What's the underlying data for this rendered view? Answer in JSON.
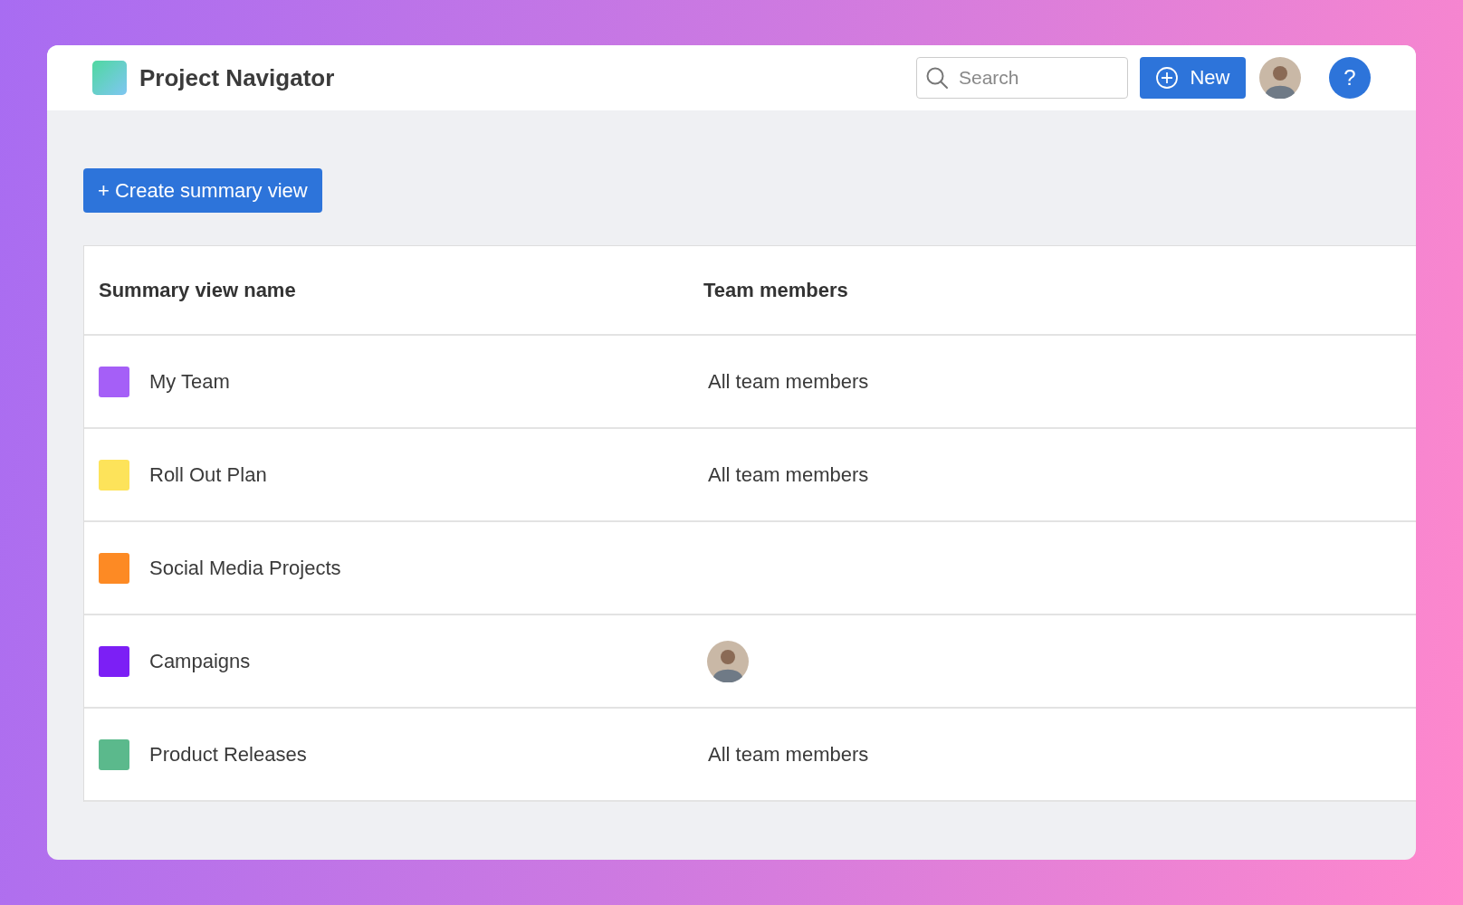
{
  "header": {
    "title": "Project Navigator",
    "search": {
      "placeholder": "Search"
    },
    "new_button": "New",
    "help_button": "?"
  },
  "create_button": "+ Create summary view",
  "table": {
    "columns": [
      "Summary view name",
      "Team members"
    ],
    "rows": [
      {
        "name": "My Team",
        "color": "#a55ff7",
        "members": {
          "kind": "text",
          "text": "All team members"
        }
      },
      {
        "name": "Roll Out Plan",
        "color": "#fde35a",
        "members": {
          "kind": "text",
          "text": "All team members"
        }
      },
      {
        "name": "Social Media Projects",
        "color": "#fd8a24"
      },
      {
        "name": "Campaigns",
        "color": "#7c1ff5",
        "members": {
          "kind": "avatar"
        }
      },
      {
        "name": "Product Releases",
        "color": "#5bb98c",
        "members": {
          "kind": "text",
          "text": "All team members"
        }
      }
    ]
  }
}
